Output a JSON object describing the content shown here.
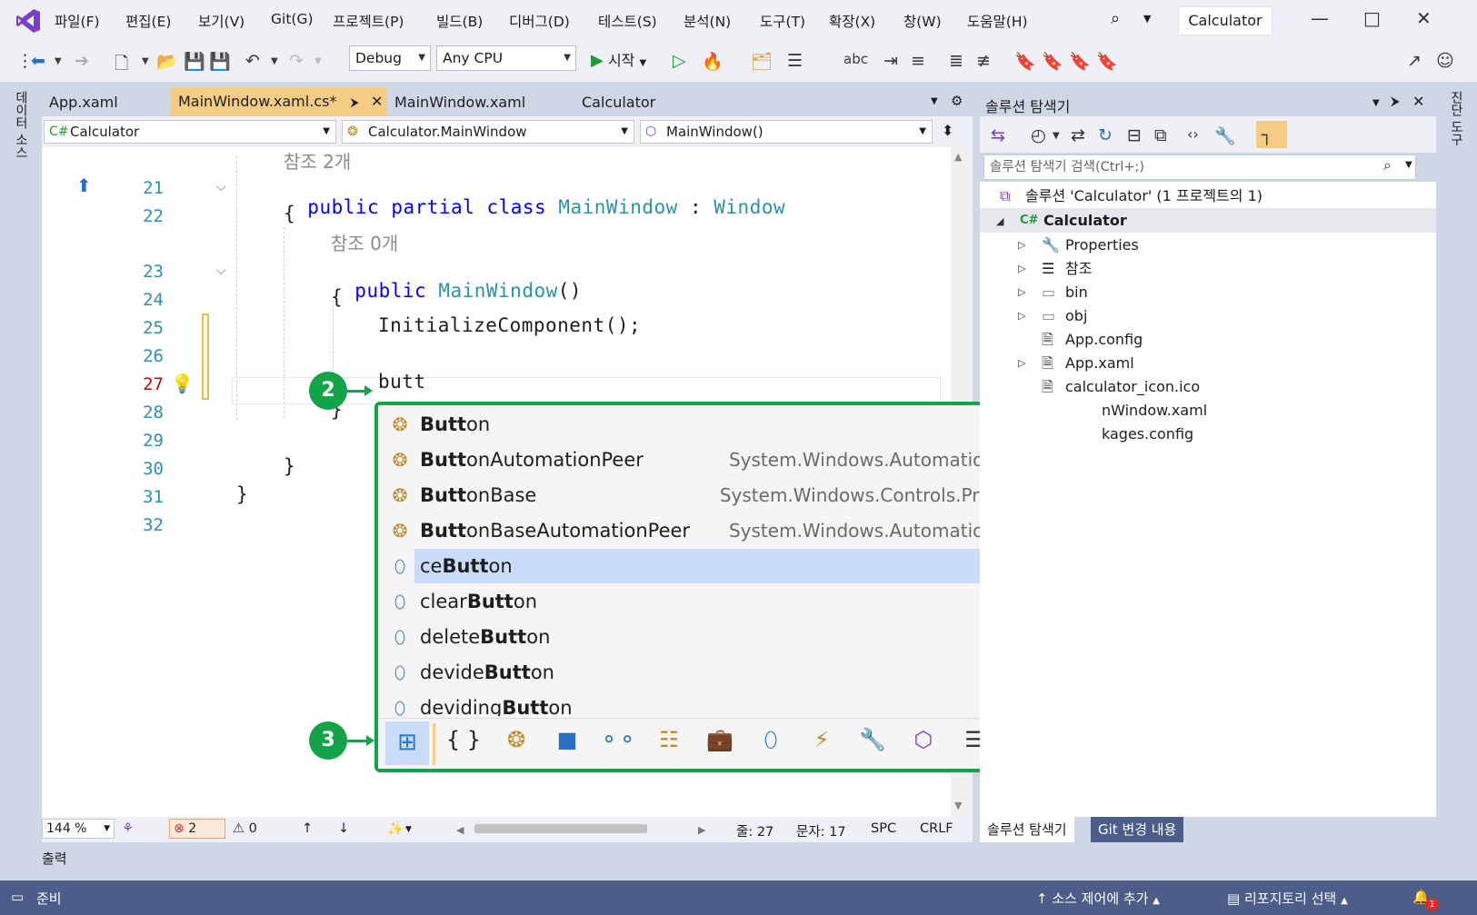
{
  "menu": {
    "items": [
      "파일(F)",
      "편집(E)",
      "보기(V)",
      "Git(G)",
      "프로젝트(P)",
      "빌드(B)",
      "디버그(D)",
      "테스트(S)",
      "분석(N)",
      "도구(T)",
      "확장(X)",
      "창(W)",
      "도움말(H)"
    ],
    "window_title": "Calculator"
  },
  "toolbar": {
    "config": "Debug",
    "platform": "Any CPU",
    "start_label": "시작"
  },
  "left_strip_label": "데이터 소스",
  "right_strip_label": "진단 도구",
  "doc_tabs": {
    "tab1": "App.xaml",
    "tab2": "MainWindow.xaml.cs*",
    "tab3": "MainWindow.xaml",
    "tab4": "Calculator"
  },
  "nav": {
    "project": "Calculator",
    "class": "Calculator.MainWindow",
    "member": "MainWindow()"
  },
  "editor": {
    "lens_class": "참조 2개",
    "lens_ctor": "참조 0개",
    "lines": {
      "l21": "21",
      "l22": "22",
      "l23": "23",
      "l24": "24",
      "l25": "25",
      "l26": "26",
      "l27": "27",
      "l28": "28",
      "l29": "29",
      "l30": "30",
      "l31": "31",
      "l32": "32"
    },
    "code": {
      "kw_public": "public",
      "kw_partial": "partial",
      "kw_class": "class",
      "type_main": "MainWindow",
      "colon": ":",
      "type_window": "Window",
      "brace_open": "{",
      "brace_close": "}",
      "ctor_public": "public",
      "ctor_name": "MainWindow",
      "ctor_parens": "()",
      "init_call": "InitializeComponent();",
      "typed": "butt"
    }
  },
  "badges": {
    "b2": "2",
    "b3": "3"
  },
  "completion": {
    "items": [
      {
        "bold": "Butt",
        "rest": "on",
        "pre": "",
        "ns": ""
      },
      {
        "bold": "Butt",
        "rest": "onAutomationPeer",
        "pre": "",
        "ns": "System.Windows.Automation.Peers"
      },
      {
        "bold": "Butt",
        "rest": "onBase",
        "pre": "",
        "ns": "System.Windows.Controls.Primitives"
      },
      {
        "bold": "Butt",
        "rest": "onBaseAutomationPeer",
        "pre": "",
        "ns": "System.Windows.Automation.Peers"
      },
      {
        "pre": "ce",
        "bold": "Butt",
        "rest": "on",
        "ns": ""
      },
      {
        "pre": "clear",
        "bold": "Butt",
        "rest": "on",
        "ns": ""
      },
      {
        "pre": "delete",
        "bold": "Butt",
        "rest": "on",
        "ns": ""
      },
      {
        "pre": "devide",
        "bold": "Butt",
        "rest": "on",
        "ns": ""
      },
      {
        "pre": "deviding",
        "bold": "Butt",
        "rest": "on",
        "ns": ""
      }
    ]
  },
  "edit_status": {
    "zoom": "144 %",
    "errors": "2",
    "warnings": "0",
    "line": "줄: 27",
    "col": "문자: 17",
    "spc": "SPC",
    "crlf": "CRLF"
  },
  "output_label": "출력",
  "solution_explorer": {
    "title": "솔루션 탐색기",
    "search_placeholder": "솔루션 탐색기 검색(Ctrl+;)",
    "solution": "솔루션 'Calculator' (1 프로젝트의 1)",
    "project": "Calculator",
    "items": {
      "properties": "Properties",
      "references": "참조",
      "bin": "bin",
      "obj": "obj",
      "app_config": "App.config",
      "app_xaml": "App.xaml",
      "icon": "calculator_icon.ico",
      "mainwindow_partial": "nWindow.xaml",
      "packages_partial": "kages.config"
    },
    "tab_se": "솔루션 탐색기",
    "tab_git": "Git 변경 내용"
  },
  "statusbar": {
    "ready": "준비",
    "source_control": "소스 제어에 추가",
    "repo": "리포지토리 선택",
    "notif_count": "1"
  }
}
